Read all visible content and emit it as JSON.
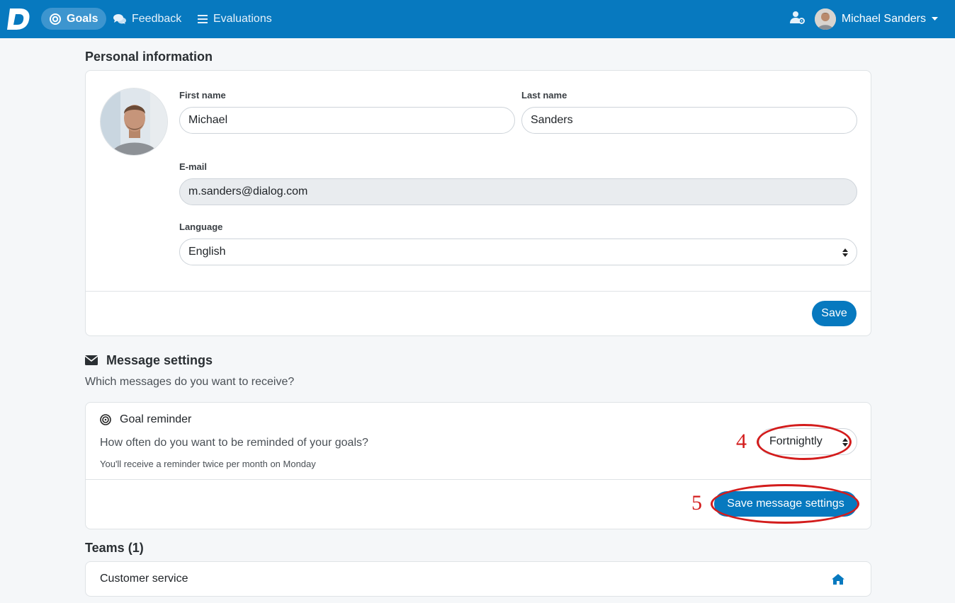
{
  "nav": {
    "logo_letter": "D",
    "items": [
      {
        "label": "Goals",
        "icon": "target-icon",
        "active": true
      },
      {
        "label": "Feedback",
        "icon": "comments-icon",
        "active": false
      },
      {
        "label": "Evaluations",
        "icon": "list-icon",
        "active": false
      }
    ],
    "user_name": "Michael Sanders",
    "brand_color": "#0779bf"
  },
  "personal_info": {
    "title": "Personal information",
    "first_name_label": "First name",
    "first_name_value": "Michael",
    "last_name_label": "Last name",
    "last_name_value": "Sanders",
    "email_label": "E-mail",
    "email_value": "m.sanders@dialog.com",
    "language_label": "Language",
    "language_value": "English",
    "save_label": "Save"
  },
  "message_settings": {
    "title": "Message settings",
    "subtitle": "Which messages do you want to receive?",
    "goal_reminder_title": "Goal reminder",
    "question": "How often do you want to be reminded of your goals?",
    "hint": "You'll receive a reminder twice per month on Monday",
    "frequency_value": "Fortnightly",
    "save_label": "Save message settings"
  },
  "teams": {
    "title": "Teams (1)",
    "items": [
      {
        "name": "Customer service"
      }
    ]
  },
  "annotations": {
    "step4": "4",
    "step5": "5",
    "color": "#d31c1c"
  }
}
